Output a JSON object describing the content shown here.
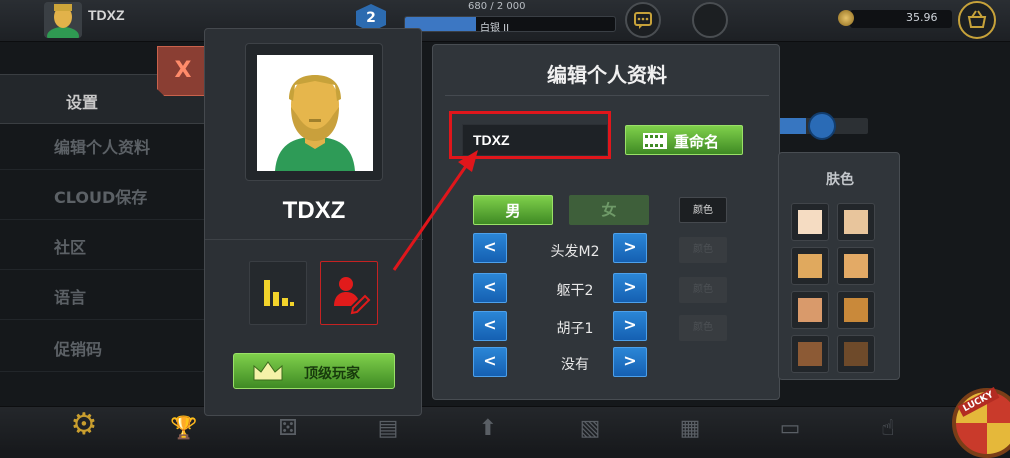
{
  "topbar": {
    "username": "TDXZ",
    "level": "2",
    "xp_text": "680 / 2 000",
    "xp_progress": 0.34,
    "rank": "白银 II",
    "coins": "35.96",
    "chat_icon": "chat-icon",
    "shop_icon": "basket-icon"
  },
  "settings_menu": {
    "title": "设置",
    "items": [
      "编辑个人资料",
      "CLOUD保存",
      "社区",
      "语言",
      "促销码"
    ]
  },
  "close_button": {
    "label": "X"
  },
  "profile": {
    "name": "TDXZ",
    "stats_icon": "bar-chart-icon",
    "edit_icon": "edit-profile-icon",
    "top_players_label": "顶级玩家"
  },
  "edit_panel": {
    "title": "编辑个人资料",
    "name_value": "TDXZ",
    "rename_label": "重命名",
    "gender_male": "男",
    "gender_female": "女",
    "color_label": "颜色",
    "prev_label": "<",
    "next_label": ">",
    "options": [
      "头发M2",
      "躯干2",
      "胡子1",
      "没有"
    ]
  },
  "skin_panel": {
    "title": "肤色",
    "colors": [
      "#f5dcc2",
      "#e8c59c",
      "#e0a95e",
      "#e3aa66",
      "#d99a6b",
      "#c9893a",
      "#8c5a35",
      "#6e4a2a"
    ]
  },
  "colors": {
    "accent_green": "#5cae35",
    "accent_blue": "#1f74c6",
    "highlight_red": "#e0161b"
  }
}
